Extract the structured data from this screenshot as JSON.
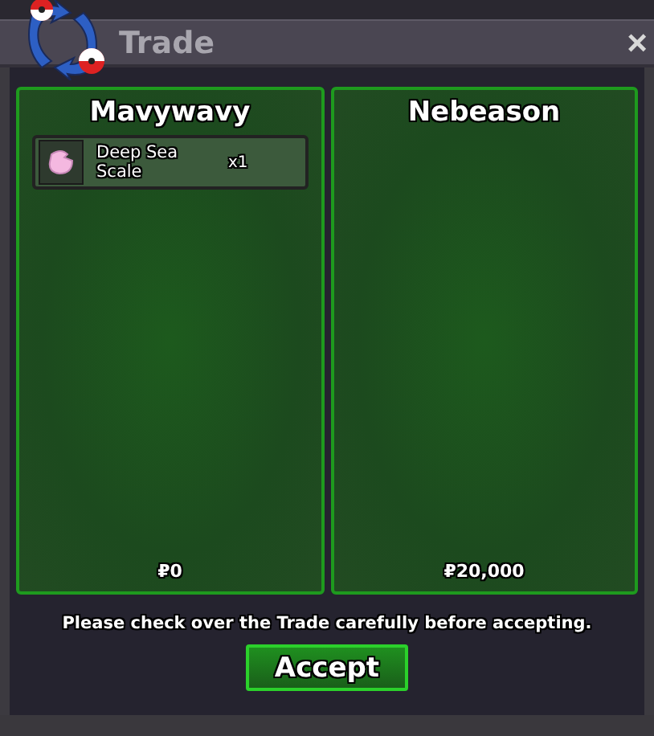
{
  "window": {
    "title": "Trade",
    "close": "×"
  },
  "parties": [
    {
      "name": "Mavywavy",
      "items": [
        {
          "name": "Deep Sea Scale",
          "quantity": "x1"
        }
      ],
      "money": "₽0"
    },
    {
      "name": "Nebeason",
      "money": "₽20,000"
    }
  ],
  "notice": "Please check over the Trade carefully before accepting.",
  "accept_button": "Accept"
}
